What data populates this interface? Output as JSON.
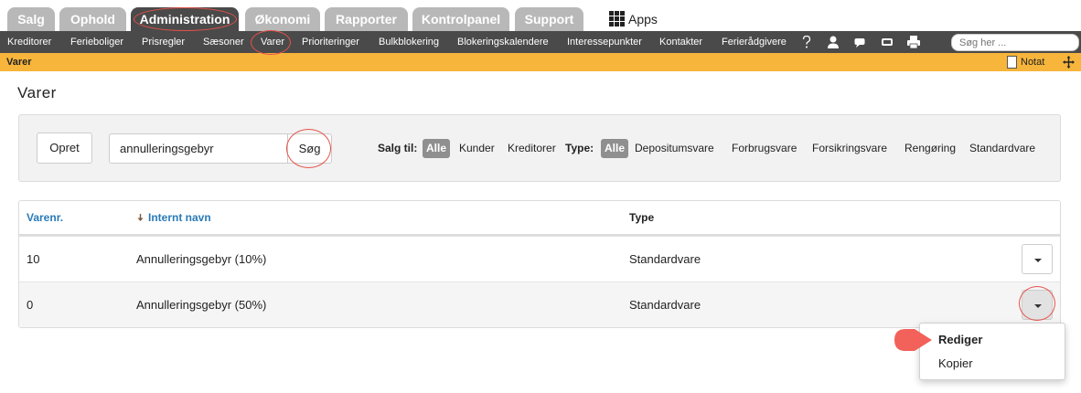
{
  "top_tabs": [
    {
      "label": "Salg"
    },
    {
      "label": "Ophold"
    },
    {
      "label": "Administration",
      "active": true
    },
    {
      "label": "Økonomi"
    },
    {
      "label": "Rapporter"
    },
    {
      "label": "Kontrolpanel"
    },
    {
      "label": "Support"
    }
  ],
  "apps_label": "Apps",
  "nav": {
    "items": [
      "Kreditorer",
      "Ferieboliger",
      "Prisregler",
      "Sæsoner",
      "Varer",
      "Prioriteringer",
      "Bulkblokering",
      "Blokeringskalendere",
      "Interessepunkter",
      "Kontakter",
      "Ferierådgivere"
    ],
    "icons": [
      "help-icon",
      "user-icon",
      "chat-icon",
      "message-icon",
      "printer-icon"
    ],
    "search_placeholder": "Søg her ..."
  },
  "subbar": {
    "title": "Varer",
    "notat_label": "Notat"
  },
  "page": {
    "title": "Varer"
  },
  "filters": {
    "create_label": "Opret",
    "search_value": "annulleringsgebyr",
    "search_button": "Søg",
    "salg_til_label": "Salg til:",
    "salg_til_options": [
      "Alle",
      "Kunder",
      "Kreditorer"
    ],
    "type_label": "Type:",
    "type_options": [
      "Alle",
      "Depositumsvare",
      "Forbrugsvare",
      "Forsikringsvare",
      "Rengøring",
      "Standardvare"
    ]
  },
  "table": {
    "headers": {
      "nr": "Varenr.",
      "name": "Internt navn",
      "type": "Type"
    },
    "rows": [
      {
        "nr": "10",
        "name": "Annulleringsgebyr (10%)",
        "type": "Standardvare"
      },
      {
        "nr": "0",
        "name": "Annulleringsgebyr (50%)",
        "type": "Standardvare"
      }
    ]
  },
  "dropdown": {
    "items": [
      "Rediger",
      "Kopier"
    ]
  },
  "colors": {
    "nav_bg": "#4a4a4a",
    "subbar_bg": "#f7b53b",
    "link": "#2a7ab8",
    "annotation": "#e8524a"
  }
}
